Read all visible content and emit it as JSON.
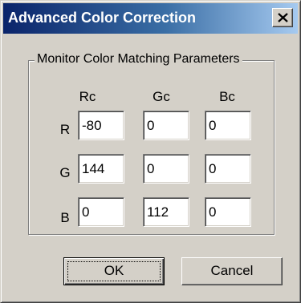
{
  "window": {
    "title": "Advanced Color Correction",
    "close_icon": "close-x-icon",
    "titlebar_colors": [
      "#0a246a",
      "#a6caf0"
    ],
    "face_color": "#d4d0c8"
  },
  "group": {
    "legend": "Monitor Color Matching Parameters"
  },
  "columns": [
    "Rc",
    "Gc",
    "Bc"
  ],
  "rows": [
    {
      "label": "R",
      "values": [
        "-80",
        "0",
        "0"
      ]
    },
    {
      "label": "G",
      "values": [
        "144",
        "0",
        "0"
      ]
    },
    {
      "label": "B",
      "values": [
        "0",
        "112",
        "0"
      ]
    }
  ],
  "buttons": {
    "ok": "OK",
    "cancel": "Cancel"
  }
}
